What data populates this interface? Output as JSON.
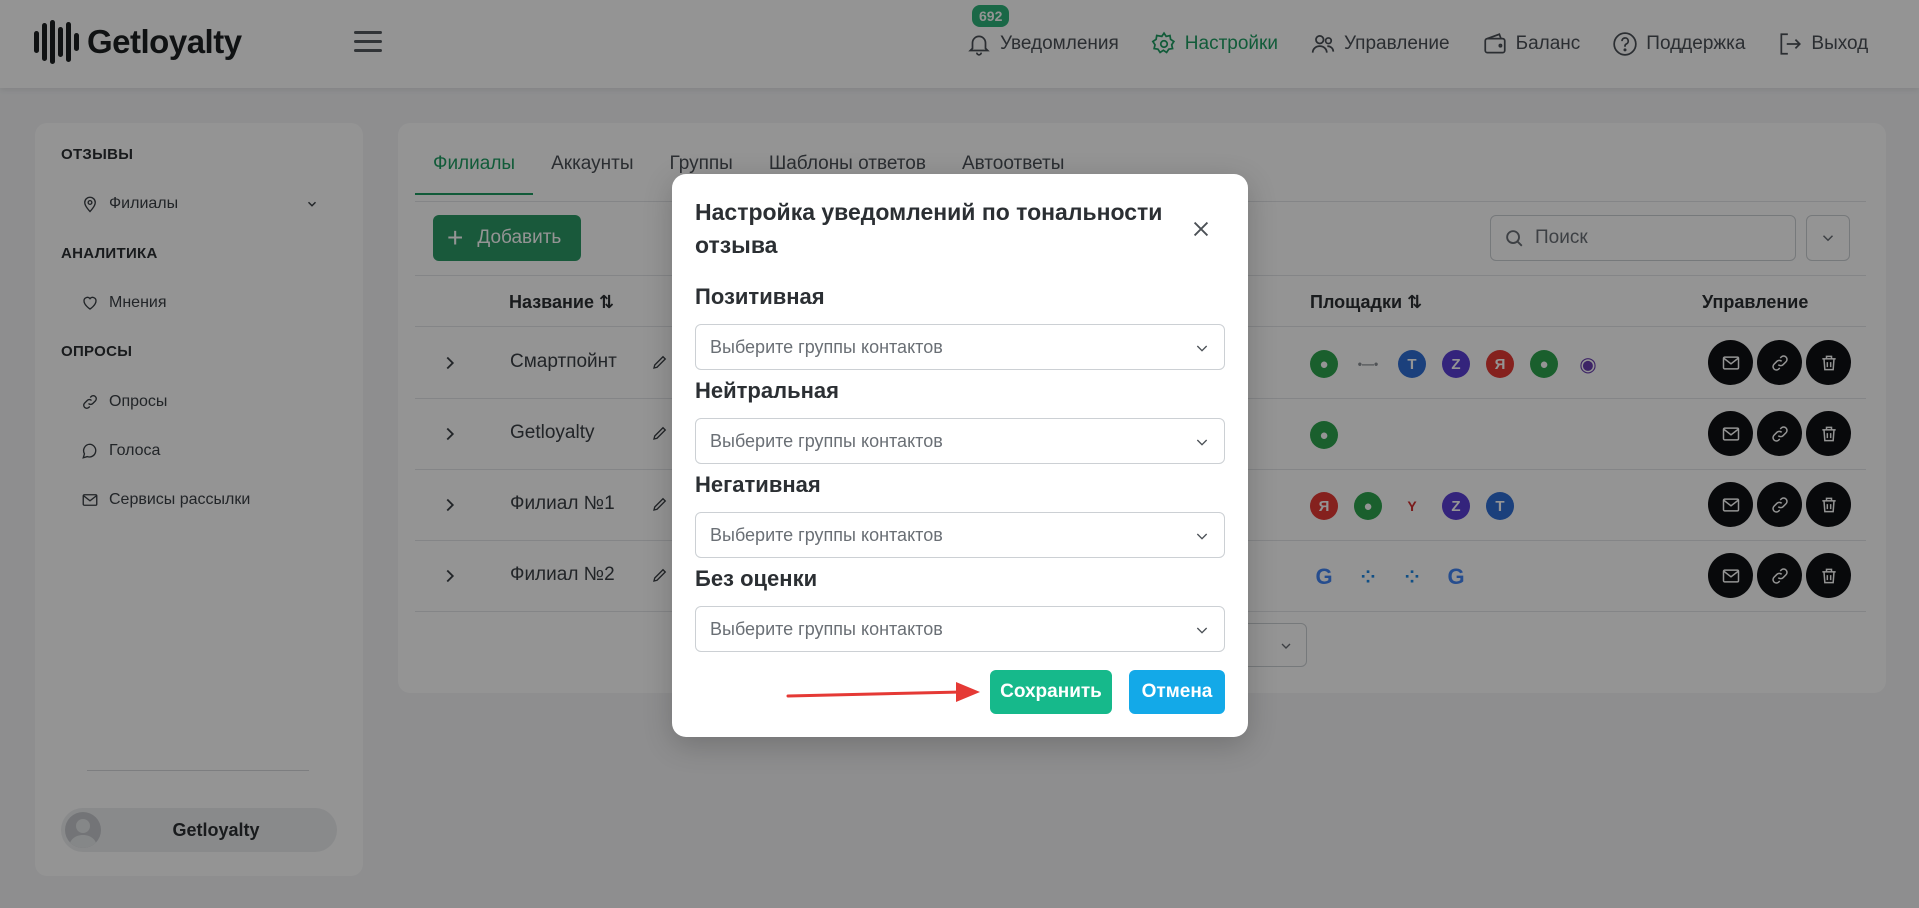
{
  "header": {
    "logo_text": "Getloyalty",
    "nav": [
      {
        "label": "Уведомления",
        "icon": "bell-icon",
        "badge": "692"
      },
      {
        "label": "Настройки",
        "icon": "gear-icon",
        "active": true
      },
      {
        "label": "Управление",
        "icon": "users-icon"
      },
      {
        "label": "Баланс",
        "icon": "wallet-icon"
      },
      {
        "label": "Поддержка",
        "icon": "help-icon"
      },
      {
        "label": "Выход",
        "icon": "logout-icon"
      }
    ]
  },
  "sidebar": {
    "sections": [
      {
        "title": "ОТЗЫВЫ",
        "items": [
          {
            "label": "Филиалы",
            "icon": "map-pin-icon"
          }
        ]
      },
      {
        "title": "АНАЛИТИКА",
        "items": [
          {
            "label": "Мнения",
            "icon": "heart-icon"
          }
        ]
      },
      {
        "title": "ОПРОСЫ",
        "items": [
          {
            "label": "Опросы",
            "icon": "link-icon"
          },
          {
            "label": "Голоса",
            "icon": "chat-icon"
          },
          {
            "label": "Сервисы рассылки",
            "icon": "mail-icon"
          }
        ]
      }
    ],
    "user_name": "Getloyalty"
  },
  "main": {
    "tabs": [
      "Филиалы",
      "Аккаунты",
      "Группы",
      "Шаблоны ответов",
      "Автоответы"
    ],
    "add_label": "Добавить",
    "search_placeholder": "Поиск",
    "columns": {
      "name": "Название",
      "platforms": "Площадки",
      "manage": "Управление"
    },
    "rows": [
      {
        "name": "Смартпойнт",
        "platforms": [
          "2gis",
          "dots",
          "tf",
          "z",
          "ya",
          "2gis",
          "globe"
        ]
      },
      {
        "name": "Getloyalty",
        "platforms": [
          "2gis"
        ]
      },
      {
        "name": "Филиал №1",
        "platforms": [
          "ya",
          "2gis",
          "yell",
          "z",
          "tf"
        ]
      },
      {
        "name": "Филиал №2",
        "platforms": [
          "google",
          "dots4",
          "dots4",
          "google"
        ]
      }
    ]
  },
  "modal": {
    "title": "Настройка уведомлений по тональности отзыва",
    "fields": [
      {
        "label": "Позитивная",
        "placeholder": "Выберите группы контактов"
      },
      {
        "label": "Нейтральная",
        "placeholder": "Выберите группы контактов"
      },
      {
        "label": "Негативная",
        "placeholder": "Выберите группы контактов"
      },
      {
        "label": "Без оценки",
        "placeholder": "Выберите группы контактов"
      }
    ],
    "save_label": "Сохранить",
    "cancel_label": "Отмена"
  },
  "colors": {
    "accent_green": "#1e9e63",
    "save_button": "#16b98b",
    "cancel_button": "#13a9e8",
    "annotation_arrow": "#e53935"
  }
}
